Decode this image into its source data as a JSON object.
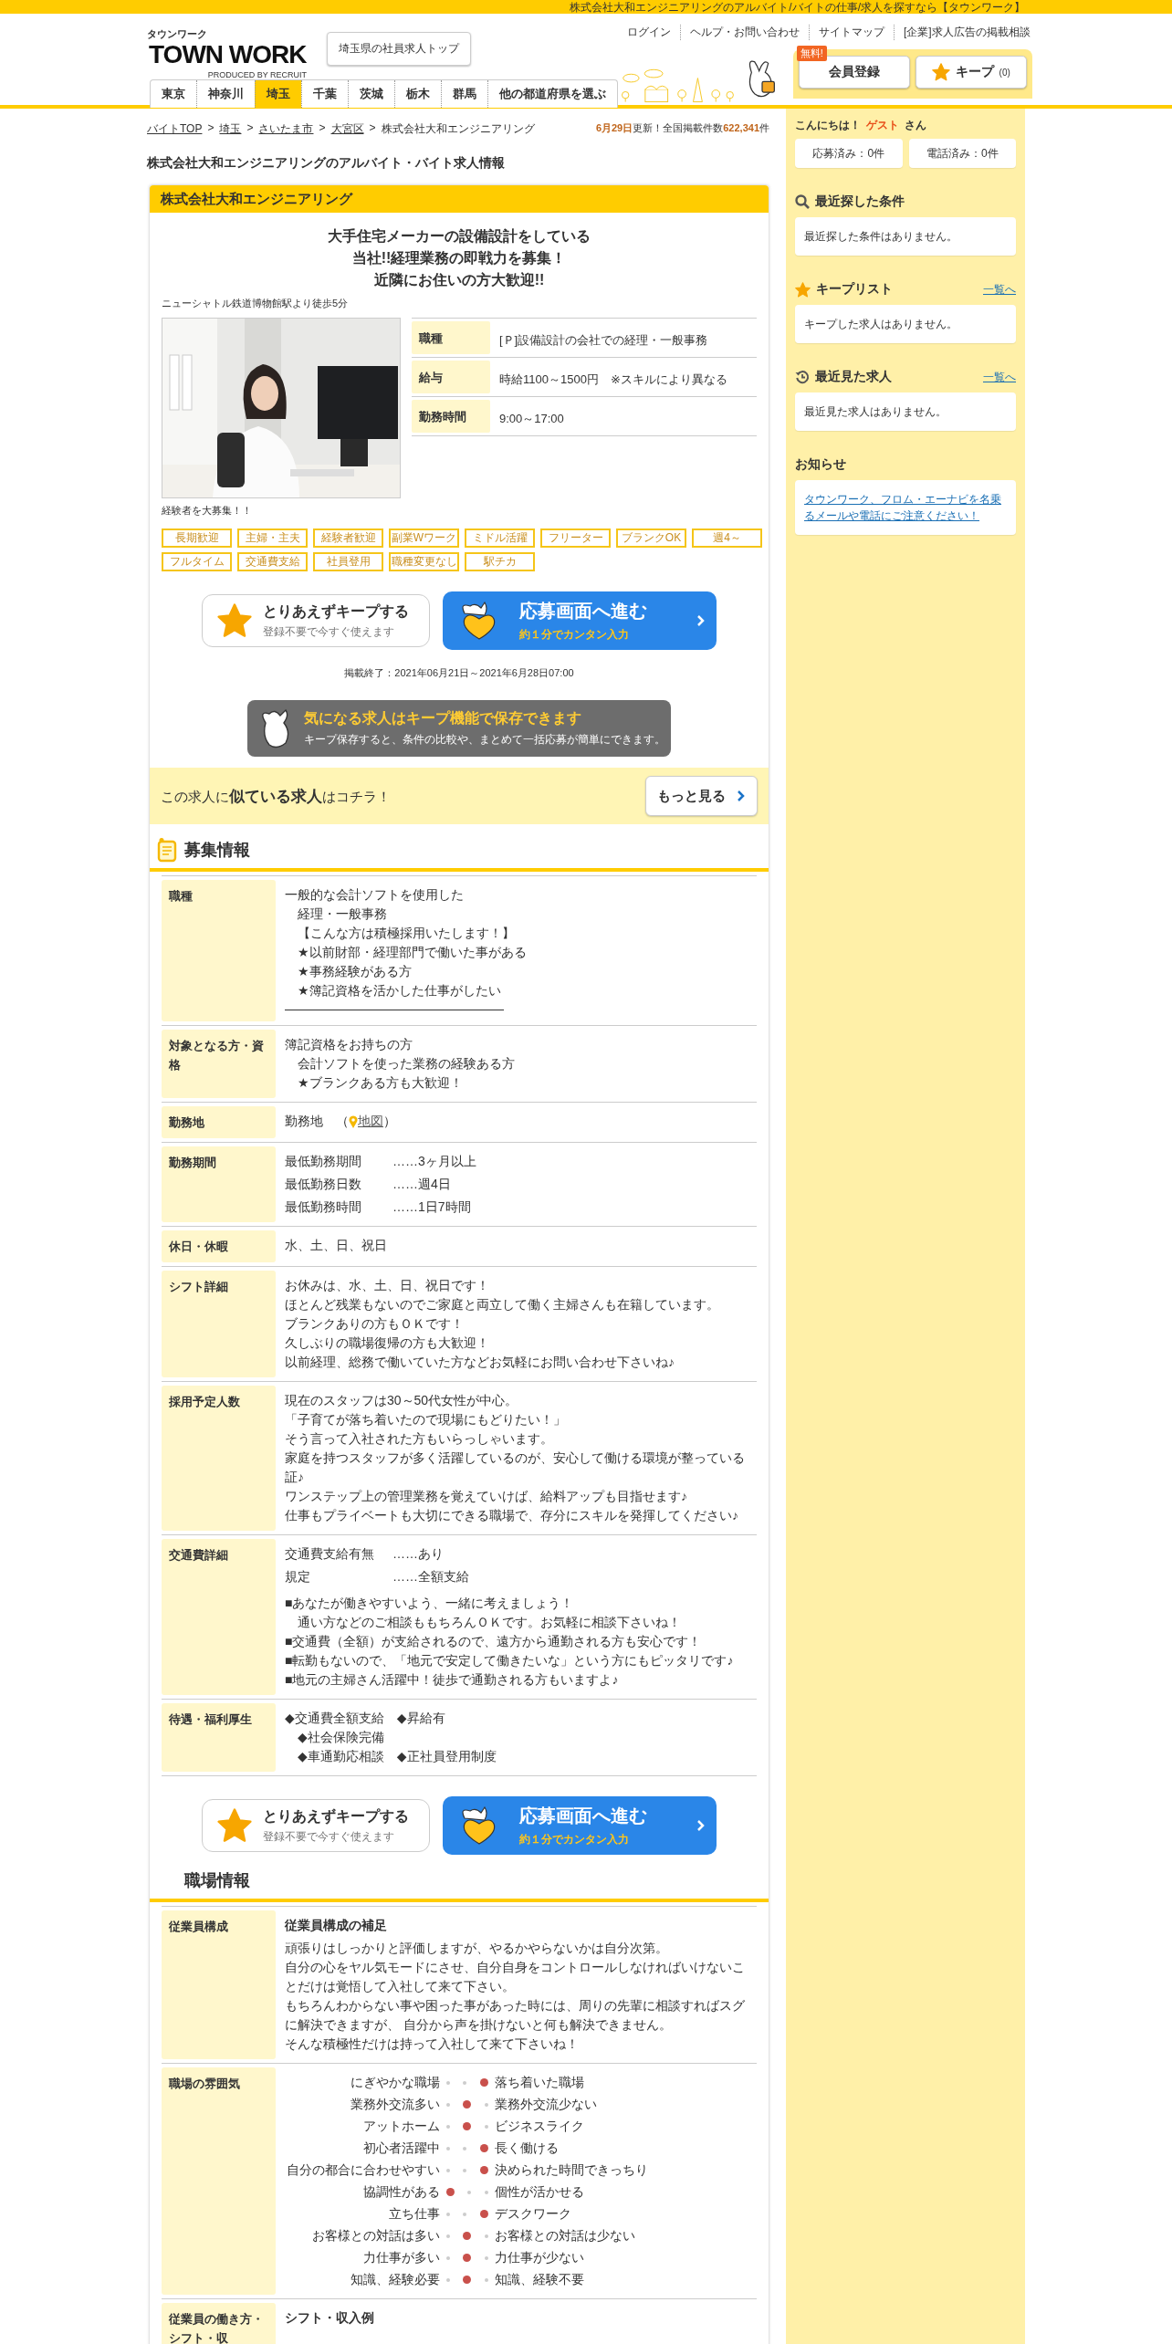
{
  "top_bar": {
    "text": "株式会社大和エンジニアリングのアルバイト/バイトの仕事/求人を探すなら【タウンワーク】"
  },
  "header": {
    "logo_kana": "タウンワーク",
    "logo": "TOWN WORK",
    "logo_sub": "PRODUCED BY RECRUIT",
    "top_link": "埼玉県の社員求人トップ",
    "links": [
      "ログイン",
      "ヘルプ・お問い合わせ",
      "サイトマップ",
      "[企業]求人広告の掲載相談"
    ],
    "badge": "無料!",
    "register": "会員登録",
    "keep": "キープ",
    "keep_count": "(0)"
  },
  "tabs": [
    {
      "label": "東京",
      "selected": false
    },
    {
      "label": "神奈川",
      "selected": false
    },
    {
      "label": "埼玉",
      "selected": true
    },
    {
      "label": "千葉",
      "selected": false
    },
    {
      "label": "茨城",
      "selected": false
    },
    {
      "label": "栃木",
      "selected": false
    },
    {
      "label": "群馬",
      "selected": false
    },
    {
      "label": "他の都道府県を選ぶ",
      "selected": false
    }
  ],
  "breadcrumbs": {
    "separator": ">",
    "items": [
      {
        "label": "バイトTOP",
        "link": true
      },
      {
        "label": "埼玉",
        "link": true
      },
      {
        "label": "さいたま市",
        "link": true
      },
      {
        "label": "大宮区",
        "link": true
      },
      {
        "label": "株式会社大和エンジニアリング",
        "link": false
      }
    ]
  },
  "update": {
    "date": "6月29日",
    "text": "更新！全国掲載件数",
    "count": "622,341",
    "unit": "件"
  },
  "page_title": "株式会社大和エンジニアリングのアルバイト・バイト求人情報",
  "job": {
    "company": "株式会社大和エンジニアリング",
    "headline": [
      "大手住宅メーカーの設備設計をしている",
      "当社!!経理業務の即戦力を募集！",
      "近隣にお住いの方大歓迎!!"
    ],
    "access": "ニューシャトル鉄道博物館駅より徒歩5分",
    "photo": {
      "kind": "picture"
    },
    "caption": "経験者を大募集！！",
    "summary": [
      {
        "label": "職種",
        "value": "[Ｐ]設備設計の会社での経理・一般事務"
      },
      {
        "label": "給与",
        "value": "時給1100～1500円　※スキルにより異なる"
      },
      {
        "label": "勤務時間",
        "value": "9:00～17:00"
      }
    ],
    "tags": [
      "長期歓迎",
      "主婦・主夫",
      "経験者歓迎",
      "副業Wワーク",
      "ミドル活躍",
      "フリーター",
      "ブランクOK",
      "週4～",
      "フルタイム",
      "交通費支給",
      "社員登用",
      "職種変更なし",
      "駅チカ"
    ]
  },
  "action_bars": [
    {
      "keep_title": "とりあえずキープする",
      "keep_sub": "登録不要で今すぐ使えます",
      "apply_title": "応募画面へ進む",
      "apply_sub": "約１分でカンタン入力"
    },
    {
      "keep_title": "とりあえずキープする",
      "keep_sub": "登録不要で今すぐ使えます",
      "apply_title": "応募画面へ進む",
      "apply_sub": "約１分でカンタン入力"
    }
  ],
  "period": "掲載終了：2021年06月21日～2021年6月28日07:00",
  "keep_banner": {
    "title": "気になる求人はキープ機能で保存できます",
    "text": "キープ保存すると、条件の比較や、まとめて一括応募が簡単にできます。"
  },
  "similar": {
    "text": "この求人に**似ている求人**はコチラ！",
    "button": "もっと見る"
  },
  "sections": [
    {
      "title": "募集情報",
      "rows": [
        {
          "label": "職種",
          "kind": "text",
          "rule": true,
          "lines": [
            "一般的な会計ソフトを使用した",
            "　経理・一般事務",
            "　【こんな方は積極採用いたします！】",
            "　★以前財部・経理部門で働いた事がある",
            "　★事務経験がある方",
            "　★簿記資格を活かした仕事がしたい"
          ]
        },
        {
          "label": "対象となる方・資格",
          "kind": "text",
          "lines": [
            "簿記資格をお持ちの方",
            "　会計ソフトを使った業務の経験ある方",
            "　★ブランクある方も大歓迎！"
          ]
        },
        {
          "label": "勤務地",
          "kind": "map",
          "prefix": "勤務地　（",
          "link": "地図",
          "suffix": "）"
        },
        {
          "label": "勤務期間",
          "kind": "pairs",
          "pairs": [
            {
              "term": "最低勤務期間",
              "value": "……3ヶ月以上"
            },
            {
              "term": "最低勤務日数",
              "value": "……週4日"
            },
            {
              "term": "最低勤務時間",
              "value": "……1日7時間"
            }
          ]
        },
        {
          "label": "休日・休暇",
          "kind": "text",
          "lines": [
            "水、土、日、祝日"
          ]
        },
        {
          "label": "シフト詳細",
          "kind": "text",
          "lines": [
            "お休みは、水、土、日、祝日です！",
            "ほとんど残業もないのでご家庭と両立して働く主婦さんも在籍しています。",
            "ブランクありの方もＯＫです！",
            "久しぶりの職場復帰の方も大歓迎！",
            "以前経理、総務で働いていた方などお気軽にお問い合わせ下さいね♪"
          ]
        },
        {
          "label": "採用予定人数",
          "kind": "text",
          "lines": [
            "現在のスタッフは30～50代女性が中心。",
            "「子育てが落ち着いたので現場にもどりたい！」",
            "そう言って入社された方もいらっしゃいます。",
            "家庭を持つスタッフが多く活躍しているのが、安心して働ける環境が整っている証♪",
            "ワンステップ上の管理業務を覚えていけば、給料アップも目指せます♪",
            "仕事もプライベートも大切にできる職場で、存分にスキルを発揮してください♪"
          ]
        },
        {
          "label": "交通費詳細",
          "kind": "pairs",
          "pairs": [
            {
              "term": "交通費支給有無",
              "value": "……あり"
            },
            {
              "term": "規定",
              "value": "……全額支給"
            }
          ],
          "lines": [
            "■あなたが働きやすいよう、一緒に考えましょう！",
            "　通い方などのご相談ももちろんＯＫです。お気軽に相談下さいね！",
            "■交通費（全額）が支給されるので、遠方から通勤される方も安心です！",
            "■転勤もないので、「地元で安定して働きたいな」という方にもピッタリです♪",
            "■地元の主婦さん活躍中！徒歩で通勤される方もいますよ♪"
          ]
        },
        {
          "label": "待遇・福利厚生",
          "kind": "text",
          "lines": [
            "◆交通費全額支給　◆昇給有",
            "　◆社会保険完備",
            "　◆車通勤応相談　◆正社員登用制度"
          ]
        }
      ]
    },
    {
      "title": "職場情報",
      "rows": [
        {
          "label": "従業員構成",
          "kind": "text",
          "subtitle": "従業員構成の補足",
          "lines": [
            "頑張りはしっかりと評価しますが、やるかやらないかは自分次第。",
            "自分の心をヤル気モードにさせ、自分自身をコントロールしなければいけないことだけは覚悟して入社して来て下さい。",
            "もちろんわからない事や困った事があった時には、周りの先輩に相談すればスグに解決できますが、 自分から声を掛けないと何も解決できません。",
            "そんな積極性だけは持って入社して来て下さいね！"
          ]
        },
        {
          "label": "職場の雰囲気",
          "kind": "atmosphere",
          "items": [
            {
              "left": "にぎやかな職場",
              "right": "落ち着いた職場",
              "scale": [
                {
                  "selected": false
                },
                {
                  "selected": false
                },
                {
                  "selected": true
                }
              ]
            },
            {
              "left": "業務外交流多い",
              "right": "業務外交流少ない",
              "scale": [
                {
                  "selected": false
                },
                {
                  "selected": true
                },
                {
                  "selected": false
                }
              ]
            },
            {
              "left": "アットホーム",
              "right": "ビジネスライク",
              "scale": [
                {
                  "selected": false
                },
                {
                  "selected": true
                },
                {
                  "selected": false
                }
              ]
            },
            {
              "left": "初心者活躍中",
              "right": "長く働ける",
              "scale": [
                {
                  "selected": false
                },
                {
                  "selected": false
                },
                {
                  "selected": true
                }
              ]
            },
            {
              "left": "自分の都合に合わせやすい",
              "right": "決められた時間できっちり",
              "scale": [
                {
                  "selected": false
                },
                {
                  "selected": false
                },
                {
                  "selected": true
                }
              ]
            },
            {
              "left": "協調性がある",
              "right": "個性が活かせる",
              "scale": [
                {
                  "selected": true
                },
                {
                  "selected": false
                },
                {
                  "selected": false
                }
              ]
            },
            {
              "left": "立ち仕事",
              "right": "デスクワーク",
              "scale": [
                {
                  "selected": false
                },
                {
                  "selected": false
                },
                {
                  "selected": true
                }
              ]
            },
            {
              "left": "お客様との対話は多い",
              "right": "お客様との対話は少ない",
              "scale": [
                {
                  "selected": false
                },
                {
                  "selected": true
                },
                {
                  "selected": false
                }
              ]
            },
            {
              "left": "力仕事が多い",
              "right": "力仕事が少ない",
              "scale": [
                {
                  "selected": false
                },
                {
                  "selected": true
                },
                {
                  "selected": false
                }
              ]
            },
            {
              "left": "知識、経験必要",
              "right": "知識、経験不要",
              "scale": [
                {
                  "selected": false
                },
                {
                  "selected": true
                },
                {
                  "selected": false
                }
              ]
            }
          ]
        },
        {
          "label": "従業員の働き方・シフト・収",
          "kind": "text",
          "subtitle": "シフト・収入例"
        }
      ]
    }
  ],
  "sidebar": {
    "greeting": "こんにちは！",
    "guest": "ゲスト",
    "honorific": "さん",
    "counts": [
      "応募済み：0件",
      "電話済み：0件"
    ],
    "panels": [
      {
        "title": "最近探した条件",
        "kind": "text",
        "text": "最近探した条件はありません。"
      },
      {
        "title": "キープリスト",
        "link": "一覧へ",
        "kind": "text",
        "text": "キープした求人はありません。"
      },
      {
        "title": "最近見た求人",
        "link": "一覧へ",
        "kind": "text",
        "text": "最近見た求人はありません。"
      },
      {
        "title": "お知らせ",
        "kind": "notice",
        "text": "タウンワーク、フロム・エーナビを名乗るメールや電話にご注意ください！"
      }
    ]
  }
}
